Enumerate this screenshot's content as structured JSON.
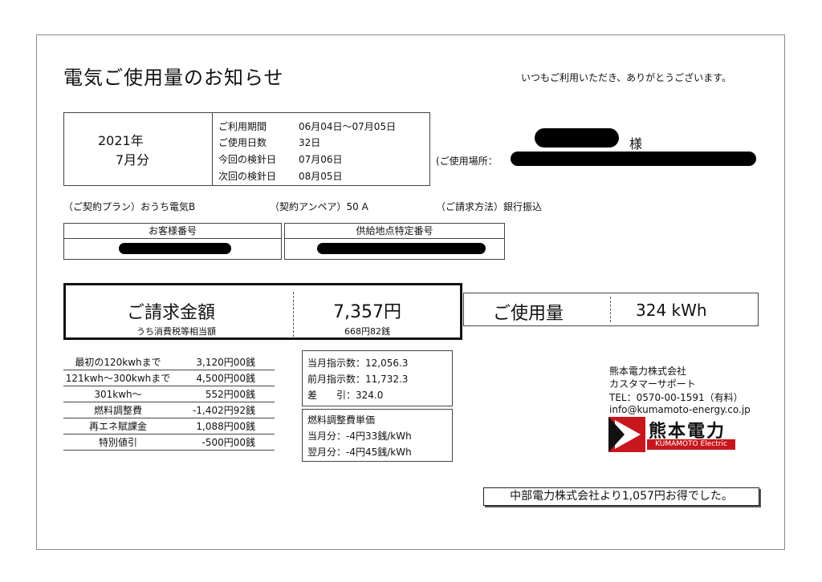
{
  "header": {
    "title": "電気ご使用量のお知らせ",
    "greeting": "いつもご利用いただき、ありがとうございます。"
  },
  "period": {
    "year": "2021年",
    "month": "7月分",
    "rows": [
      {
        "label": "ご利用期間",
        "value": "06月04日〜07月05日"
      },
      {
        "label": "ご使用日数",
        "value": "32日"
      },
      {
        "label": "今回の検針日",
        "value": "07月06日"
      },
      {
        "label": "次回の検針日",
        "value": "08月05日"
      }
    ]
  },
  "customer": {
    "honorific": "様",
    "place_label": "(ご使用場所："
  },
  "contract": {
    "plan": "（ご契約プラン）おうち電気B",
    "ampere": "（契約アンペア）50 A",
    "payment": "（ご請求方法）銀行振込"
  },
  "ids": {
    "customer_no_label": "お客様番号",
    "supply_point_label": "供給地点特定番号"
  },
  "billing": {
    "title": "ご請求金額",
    "amount": "7,357円",
    "tax_label": "うち消費税等相当額",
    "tax_amount": "668円82銭"
  },
  "usage": {
    "title": "ご使用量",
    "value": "324 kWh"
  },
  "fees": [
    {
      "label": "最初の120kwhまで",
      "value": "3,120円00銭"
    },
    {
      "label": "121kwh〜300kwhまで",
      "value": "4,500円00銭"
    },
    {
      "label": "301kwh〜",
      "value": "552円00銭"
    },
    {
      "label": "燃料調整費",
      "value": "-1,402円92銭"
    },
    {
      "label": "再エネ賦課金",
      "value": "1,088円00銭"
    },
    {
      "label": "特別値引",
      "value": "-500円00銭"
    }
  ],
  "meter": {
    "current": "当月指示数：12,056.3",
    "previous": "前月指示数：11,732.3",
    "diff": "差　　引：324.0"
  },
  "fuel": {
    "title": "燃料調整費単価",
    "this_month": "当月分：-4円33銭/kWh",
    "next_month": "翌月分：-4円45銭/kWh"
  },
  "company": {
    "name": "熊本電力株式会社",
    "dept": "カスタマーサポート",
    "tel": "TEL：0570-00-1591（有料）",
    "email": "info@kumamoto-energy.co.jp",
    "logo_text": "熊本電力",
    "logo_sub": "KUMAMOTO Electric Power",
    "brand_color": "#c8161d"
  },
  "savings": "中部電力株式会社より1,057円お得でした。"
}
